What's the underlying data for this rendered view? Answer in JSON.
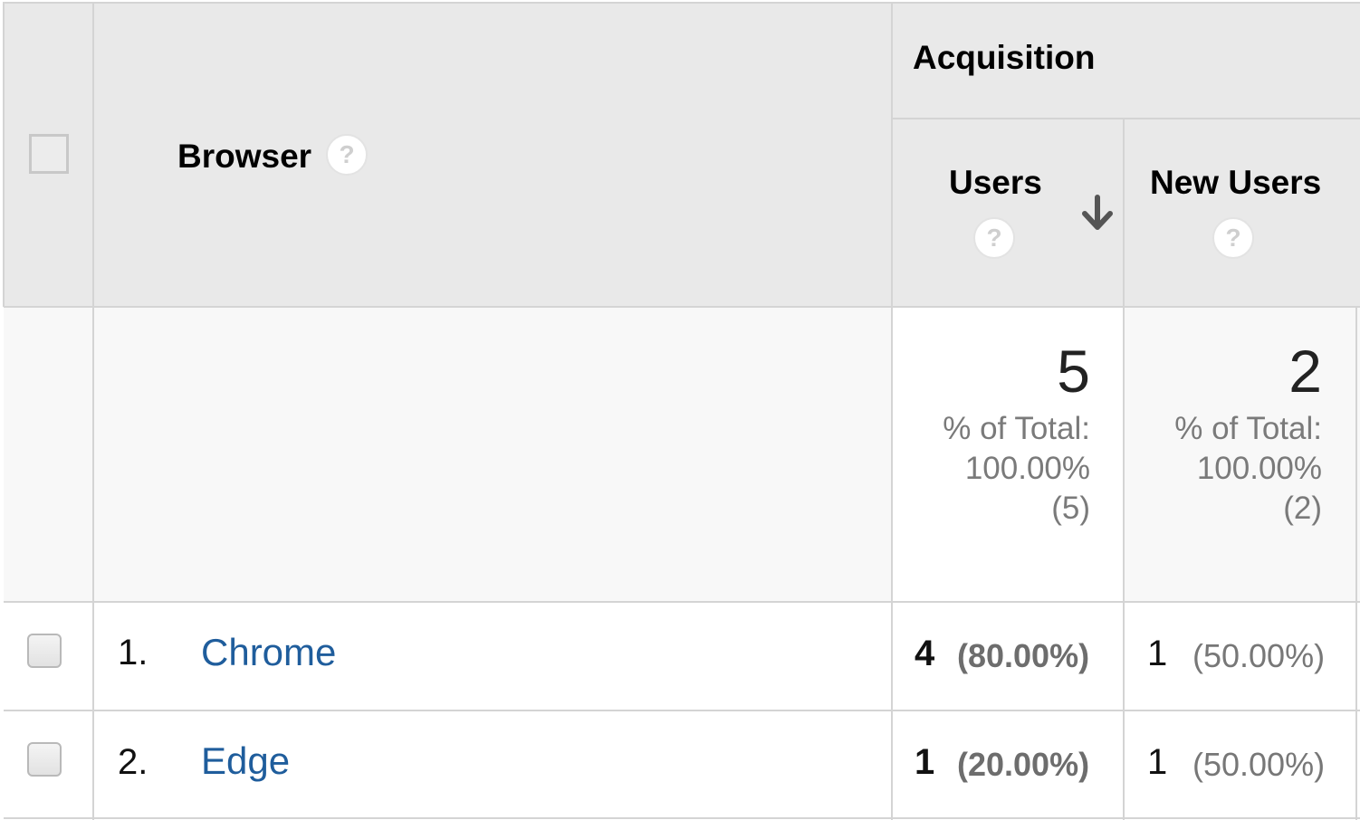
{
  "header": {
    "group_label": "Acquisition",
    "dimension_label": "Browser",
    "help_glyph": "?",
    "sort_icon": "arrow-down-icon",
    "columns": [
      {
        "label": "Users",
        "sorted": true
      },
      {
        "label": "New Users",
        "sorted": false
      }
    ]
  },
  "totals": [
    {
      "value": "5",
      "pct_label": "% of Total:",
      "pct_value": "100.00%",
      "base": "(5)"
    },
    {
      "value": "2",
      "pct_label": "% of Total:",
      "pct_value": "100.00%",
      "base": "(2)"
    }
  ],
  "rows": [
    {
      "index": "1.",
      "browser": "Chrome",
      "users": "4",
      "users_pct": "(80.00%)",
      "new_users": "1",
      "new_users_pct": "(50.00%)"
    },
    {
      "index": "2.",
      "browser": "Edge",
      "users": "1",
      "users_pct": "(20.00%)",
      "new_users": "1",
      "new_users_pct": "(50.00%)"
    }
  ],
  "colors": {
    "header_bg": "#e9e9e9",
    "totals_bg": "#f8f8f8",
    "link": "#1f5d9c",
    "grid": "#d4d4d4"
  }
}
